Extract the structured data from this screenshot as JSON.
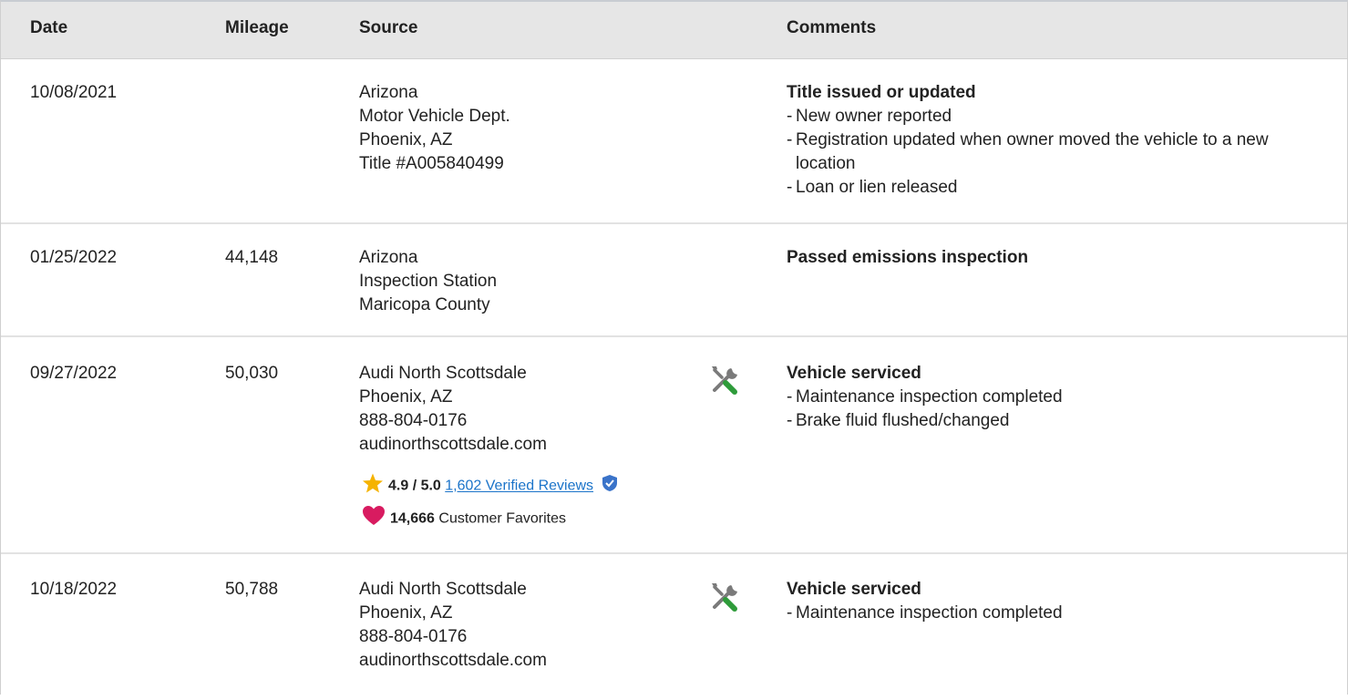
{
  "header": {
    "date": "Date",
    "mileage": "Mileage",
    "source": "Source",
    "comments": "Comments"
  },
  "rows": [
    {
      "date": "10/08/2021",
      "mileage": "",
      "source": [
        "Arizona",
        "Motor Vehicle Dept.",
        "Phoenix, AZ",
        "Title #A005840499"
      ],
      "comment_title": "Title issued or updated",
      "comment_items": [
        "New owner reported",
        "Registration updated when owner moved the vehicle to a new location",
        "Loan or lien released"
      ],
      "icon": ""
    },
    {
      "date": "01/25/2022",
      "mileage": "44,148",
      "source": [
        "Arizona",
        "Inspection Station",
        "Maricopa County"
      ],
      "comment_title": "Passed emissions inspection",
      "comment_items": [],
      "icon": ""
    },
    {
      "date": "09/27/2022",
      "mileage": "50,030",
      "source": [
        "Audi North Scottsdale",
        "Phoenix, AZ",
        "888-804-0176",
        "audinorthscottsdale.com"
      ],
      "comment_title": "Vehicle serviced",
      "comment_items": [
        "Maintenance inspection completed",
        "Brake fluid flushed/changed"
      ],
      "icon": "service-wrench-icon",
      "rating": {
        "score": "4.9 / 5.0",
        "reviews_link": "1,602 Verified Reviews",
        "favorites_count": "14,666",
        "favorites_label": "Customer Favorites"
      }
    },
    {
      "date": "10/18/2022",
      "mileage": "50,788",
      "source": [
        "Audi North Scottsdale",
        "Phoenix, AZ",
        "888-804-0176",
        "audinorthscottsdale.com"
      ],
      "comment_title": "Vehicle serviced",
      "comment_items": [
        "Maintenance inspection completed"
      ],
      "icon": "service-wrench-icon"
    }
  ],
  "colors": {
    "header_bg": "#e6e6e6",
    "link": "#1a73c9",
    "star": "#f5b300",
    "heart": "#d81b60",
    "wrench_gray": "#7a7a7a",
    "wrench_green": "#2e9b3a",
    "verified_badge": "#3a73c9"
  }
}
